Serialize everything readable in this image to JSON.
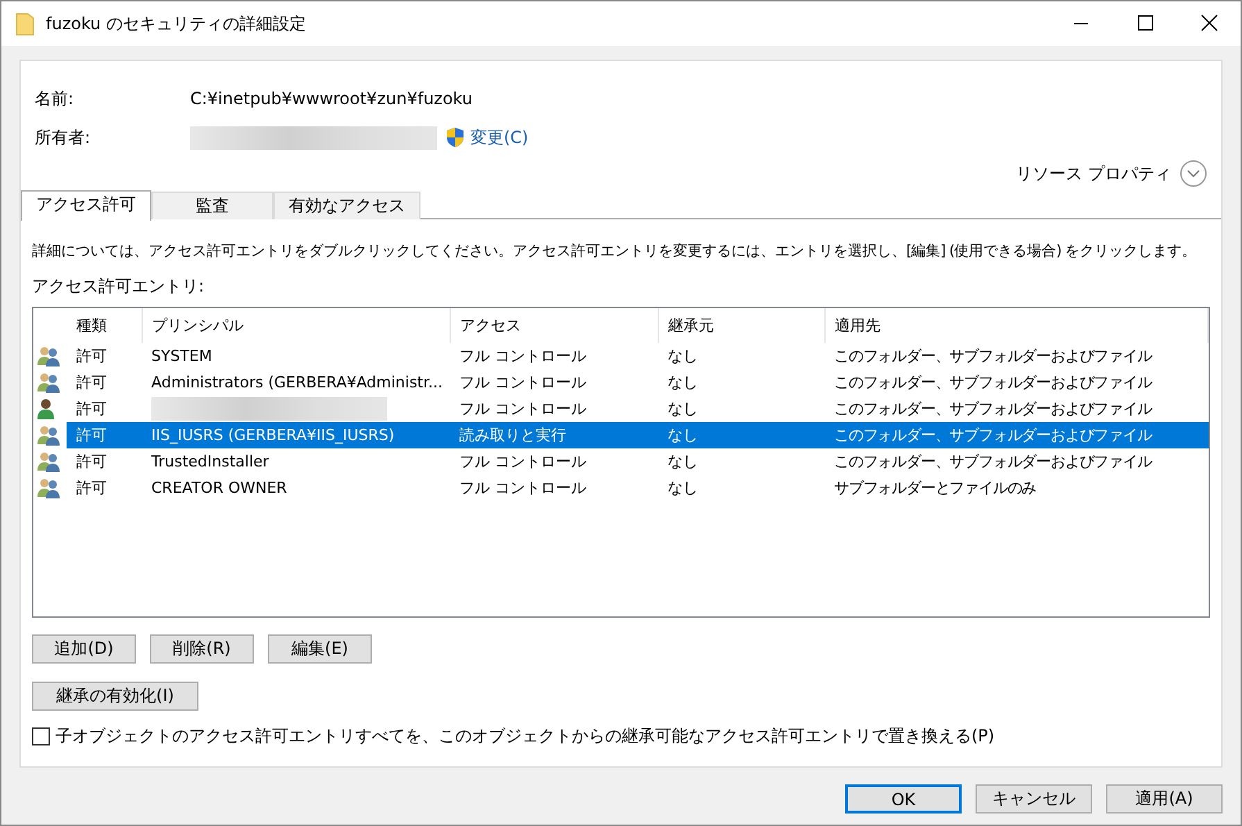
{
  "window": {
    "title": "fuzoku のセキュリティの詳細設定"
  },
  "name": {
    "label": "名前:",
    "value": "C:¥inetpub¥wwwroot¥zun¥fuzoku"
  },
  "owner": {
    "label": "所有者:",
    "change_link": "変更(C)"
  },
  "resource_properties": "リソース プロパティ",
  "tabs": [
    {
      "label": "アクセス許可",
      "selected": true
    },
    {
      "label": "監査",
      "selected": false
    },
    {
      "label": "有効なアクセス",
      "selected": false
    }
  ],
  "description": "詳細については、アクセス許可エントリをダブルクリックしてください。アクセス許可エントリを変更するには、エントリを選択し、[編集] (使用できる場合) をクリックします。",
  "entries_label": "アクセス許可エントリ:",
  "table": {
    "columns": [
      "種類",
      "プリンシパル",
      "アクセス",
      "継承元",
      "適用先"
    ],
    "rows": [
      {
        "kind": "group",
        "selected": false,
        "type": "許可",
        "principal": "SYSTEM",
        "access": "フル コントロール",
        "inherited_from": "なし",
        "applies_to": "このフォルダー、サブフォルダーおよびファイル"
      },
      {
        "kind": "group",
        "selected": false,
        "type": "許可",
        "principal": "Administrators (GERBERA¥Administr...",
        "access": "フル コントロール",
        "inherited_from": "なし",
        "applies_to": "このフォルダー、サブフォルダーおよびファイル"
      },
      {
        "kind": "user",
        "selected": false,
        "type": "許可",
        "access": "フル コントロール",
        "inherited_from": "なし",
        "applies_to": "このフォルダー、サブフォルダーおよびファイル"
      },
      {
        "kind": "group",
        "selected": true,
        "type": "許可",
        "principal": "IIS_IUSRS (GERBERA¥IIS_IUSRS)",
        "access": "読み取りと実行",
        "inherited_from": "なし",
        "applies_to": "このフォルダー、サブフォルダーおよびファイル"
      },
      {
        "kind": "group",
        "selected": false,
        "type": "許可",
        "principal": "TrustedInstaller",
        "access": "フル コントロール",
        "inherited_from": "なし",
        "applies_to": "このフォルダー、サブフォルダーおよびファイル"
      },
      {
        "kind": "group",
        "selected": false,
        "type": "許可",
        "principal": "CREATOR OWNER",
        "access": "フル コントロール",
        "inherited_from": "なし",
        "applies_to": "サブフォルダーとファイルのみ"
      }
    ]
  },
  "entry_buttons": [
    "追加(D)",
    "削除(R)",
    "編集(E)"
  ],
  "inheritance_button": "継承の有効化(I)",
  "replace_checkbox": {
    "label": "子オブジェクトのアクセス許可エントリすべてを、このオブジェクトからの継承可能なアクセス許可エントリで置き換える(P)",
    "checked": false
  },
  "dialog_buttons": [
    {
      "label": "OK",
      "default": true
    },
    {
      "label": "キャンセル",
      "default": false
    },
    {
      "label": "適用(A)",
      "default": false
    }
  ]
}
